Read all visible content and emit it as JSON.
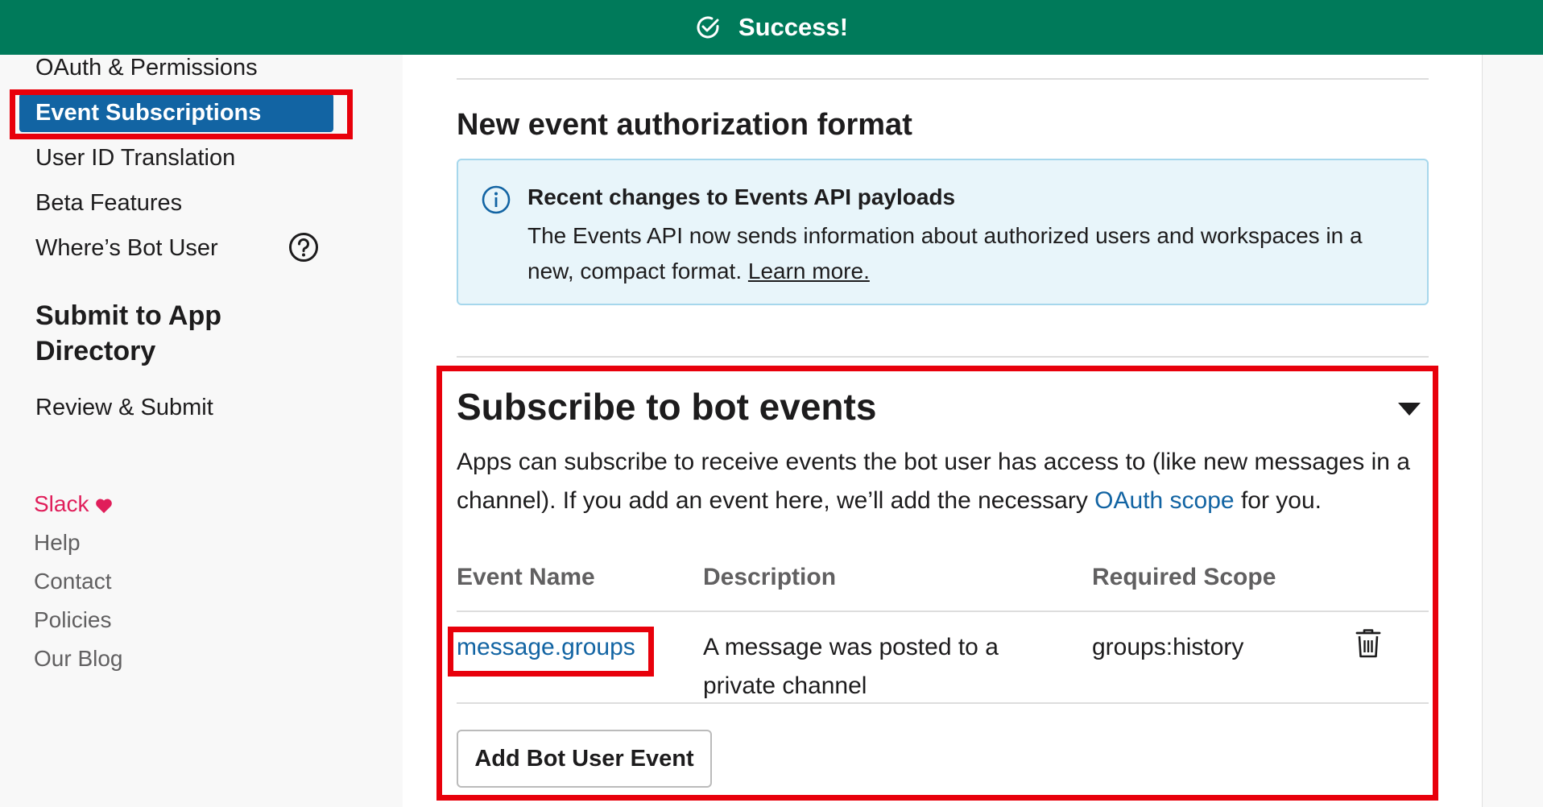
{
  "banner": {
    "message": "Success!",
    "icon": "check-circle-icon",
    "color": "#007a5a"
  },
  "sidebar": {
    "items": [
      {
        "label": "OAuth & Permissions"
      },
      {
        "label": "Event Subscriptions",
        "active": true
      },
      {
        "label": "User ID Translation"
      },
      {
        "label": "Beta Features"
      },
      {
        "label": "Where’s Bot User",
        "icon": "question-circle-icon"
      }
    ],
    "heading": "Submit to App Directory",
    "review_label": "Review & Submit",
    "footer": {
      "slack": "Slack",
      "heart_icon": "heart-icon",
      "links": [
        "Help",
        "Contact",
        "Policies",
        "Our Blog"
      ]
    }
  },
  "auth_format": {
    "title": "New event authorization format",
    "info_icon": "info-circle-icon",
    "info_title": "Recent changes to Events API payloads",
    "info_body": "The Events API now sends information about authorized users and workspaces in a new, compact format.",
    "learn_more": "Learn more."
  },
  "bot_events": {
    "title": "Subscribe to bot events",
    "caret_icon": "caret-down-icon",
    "desc_before": "Apps can subscribe to receive events the bot user has access to (like new messages in a channel). If you add an event here, we’ll add the necessary",
    "desc_link": "OAuth scope",
    "desc_after": "for you.",
    "columns": [
      "Event Name",
      "Description",
      "Required Scope"
    ],
    "rows": [
      {
        "event": "message.groups",
        "description": "A message was posted to a private channel",
        "scope": "groups:history",
        "delete_icon": "trash-icon"
      }
    ],
    "add_button": "Add Bot User Event"
  },
  "colors": {
    "accent": "#1264a3",
    "highlight": "#e8000b",
    "slack": "#e01e5a"
  }
}
